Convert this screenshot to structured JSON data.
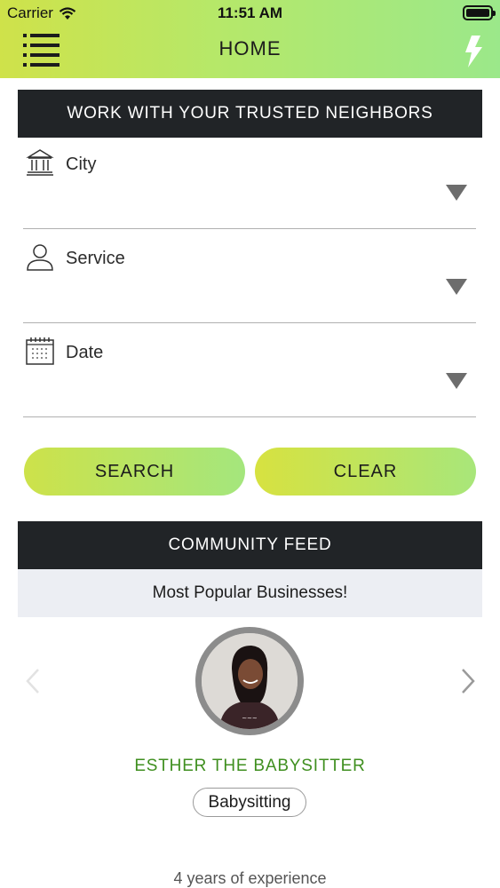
{
  "status_bar": {
    "carrier": "Carrier",
    "time": "11:51 AM",
    "wifi_icon": "wifi-icon",
    "battery_icon": "battery-icon"
  },
  "nav_bar": {
    "title": "HOME",
    "menu_icon": "hamburger-menu-icon",
    "right_icon": "lightning-bolt-icon",
    "gradient": [
      "#cfe24a",
      "#9be88a"
    ]
  },
  "search_panel": {
    "header": "WORK WITH YOUR TRUSTED NEIGHBORS",
    "fields": [
      {
        "icon": "bank-building-icon",
        "label": "City"
      },
      {
        "icon": "person-icon",
        "label": "Service"
      },
      {
        "icon": "calendar-icon",
        "label": "Date"
      }
    ],
    "search_label": "SEARCH",
    "clear_label": "CLEAR"
  },
  "community_feed": {
    "header": "COMMUNITY FEED",
    "subheader": "Most Popular Businesses!",
    "featured": {
      "name": "ESTHER THE BABYSITTER",
      "category": "Babysitting",
      "experience": "4 years of experience",
      "name_color": "#3f8f1f"
    }
  },
  "colors": {
    "header_bg": "#212427",
    "subbar_bg": "#eceef3",
    "accent_green": "#3f8f1f"
  }
}
